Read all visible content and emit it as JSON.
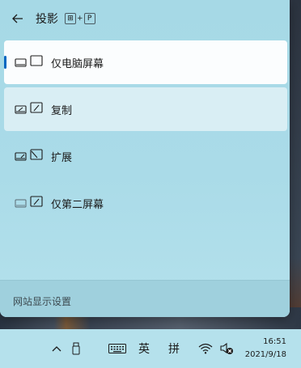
{
  "panel": {
    "title": "投影",
    "shortcut": {
      "key1": "⊞",
      "plus": "+",
      "key2": "P"
    }
  },
  "options": [
    {
      "label": "仅电脑屏幕",
      "icon": "pc-screen-only-icon",
      "state": "selected"
    },
    {
      "label": "复制",
      "icon": "duplicate-icon",
      "state": "hover"
    },
    {
      "label": "扩展",
      "icon": "extend-icon",
      "state": "normal"
    },
    {
      "label": "仅第二屏幕",
      "icon": "second-screen-only-icon",
      "state": "normal"
    }
  ],
  "footer": {
    "link": "网站显示设置"
  },
  "taskbar": {
    "ime_lang": "英",
    "ime_mode": "拼",
    "time": "16:51",
    "date": "2021/9/18"
  },
  "colors": {
    "accent": "#0067c0",
    "flyout_bg": "#aadbe8",
    "selected_bg": "#fbfdfe",
    "hover_bg": "#d9eef4",
    "taskbar_bg": "#b5e1ec"
  }
}
